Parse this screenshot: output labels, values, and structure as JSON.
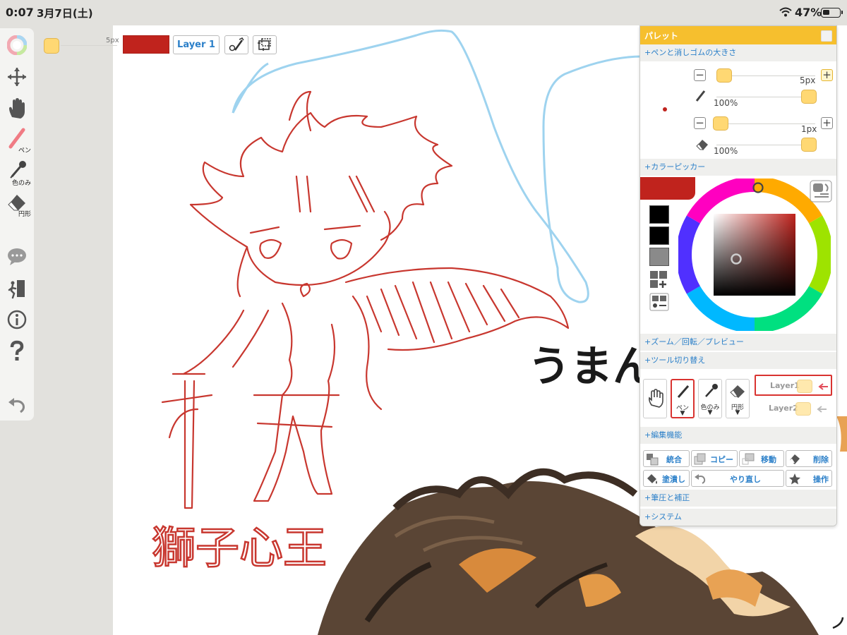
{
  "status_bar": {
    "time": "0:07",
    "date": "3月7日(土)",
    "battery": "47%"
  },
  "left_toolbar": {
    "pen_label": "ペン",
    "eyedropper_label": "色のみ",
    "eraser_label": "円形"
  },
  "top_bar": {
    "size": "5px",
    "color": "#c0231d",
    "layer": "Layer 1"
  },
  "palette": {
    "title": "パレット",
    "section_size": "+ペンと消しゴムの大きさ",
    "pen_size": "5px",
    "pen_opacity": "100%",
    "eraser_size": "1px",
    "eraser_opacity": "100%",
    "section_picker": "+カラーピッカー",
    "current_color": "#c0231d",
    "section_zoom": "+ズーム／回転／プレビュー",
    "section_tools": "+ツール切り替え",
    "tools": {
      "pen": "ペン",
      "eyedropper": "色のみ",
      "eraser": "円形"
    },
    "layers": [
      {
        "name": "Layer1",
        "selected": true
      },
      {
        "name": "Layer2",
        "selected": false
      }
    ],
    "section_edit": "+編集機能",
    "edit_buttons": {
      "merge": "統合",
      "copy": "コピー",
      "move": "移動",
      "delete": "削除",
      "fill": "塗潰し",
      "redo": "やり直し",
      "operate": "操作"
    },
    "section_pressure": "+筆圧と補正",
    "section_system": "+システム"
  },
  "canvas": {
    "caption_red": "獅子心王",
    "caption_black": "うまん"
  }
}
